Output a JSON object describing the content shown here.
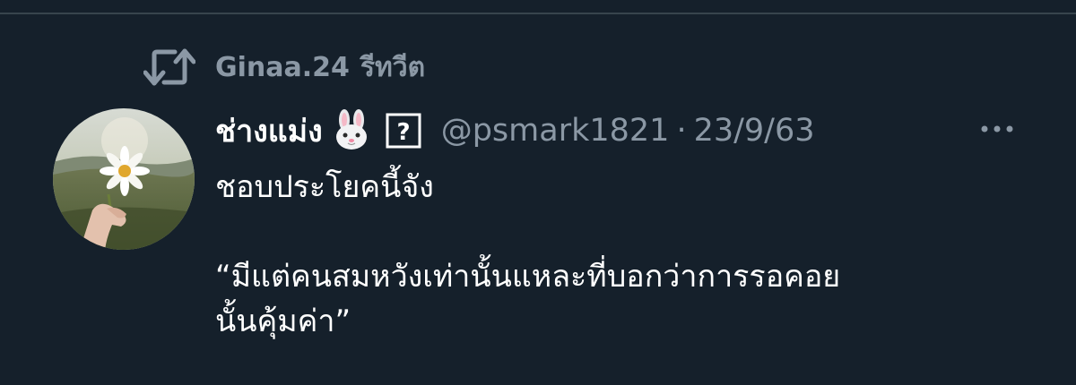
{
  "retweet": {
    "user": "Ginaa.24",
    "label": "รีทวีต",
    "icon": "retweet-icon"
  },
  "tweet": {
    "display_name": "ช่างแม่ง",
    "emoji": "rabbit-face-emoji",
    "unknown_glyph": "?",
    "handle": "@psmark1821",
    "separator": "·",
    "date": "23/9/63",
    "more_icon": "more-horizontal-icon",
    "text": {
      "line1": "ชอบประโยคนี้จัง",
      "quote_line1": "“มีแต่คนสมหวังเท่านั้นแหละที่บอกว่าการรอคอย",
      "quote_line2": "นั้นคุ้มค่า”"
    }
  },
  "colors": {
    "background": "#15202b",
    "secondary_text": "#8b98a5",
    "primary_text": "#ffffff",
    "divider": "#38444d"
  }
}
